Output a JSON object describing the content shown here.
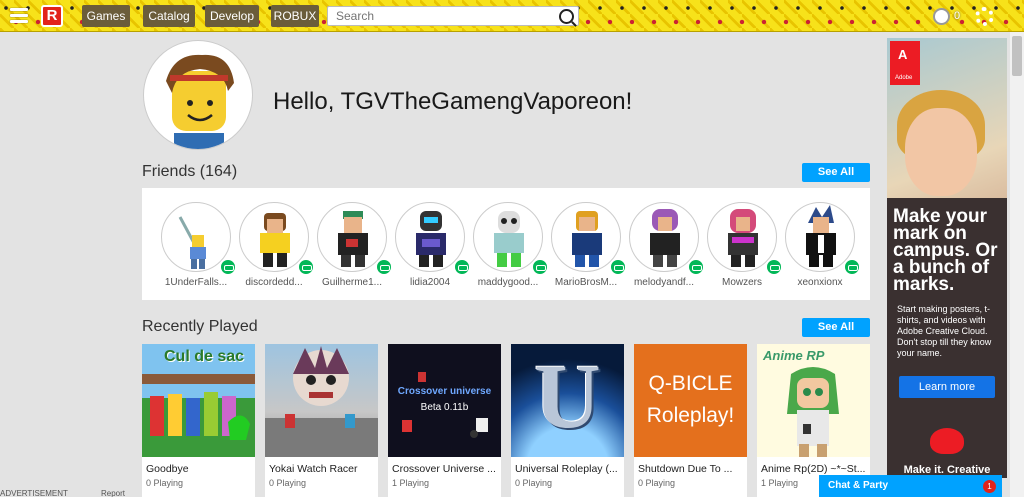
{
  "nav": {
    "logo": "R",
    "items": [
      "Games",
      "Catalog",
      "Develop",
      "ROBUX"
    ],
    "search_placeholder": "Search",
    "robux_count": "0"
  },
  "profile": {
    "greeting": "Hello, TGVTheGamengVaporeon!"
  },
  "friends": {
    "title": "Friends (164)",
    "see_all": "See All",
    "items": [
      {
        "name": "1UnderFalls..."
      },
      {
        "name": "discordedd..."
      },
      {
        "name": "Guilherme1..."
      },
      {
        "name": "lidia2004"
      },
      {
        "name": "maddygood..."
      },
      {
        "name": "MarioBrosM..."
      },
      {
        "name": "melodyandf..."
      },
      {
        "name": "Mowzers"
      },
      {
        "name": "xeonxionx"
      }
    ]
  },
  "recently_played": {
    "title": "Recently Played",
    "see_all": "See All",
    "games": [
      {
        "title": "Goodbye",
        "playing": "0 Playing",
        "thumb_text": "Cul de sac"
      },
      {
        "title": "Yokai Watch Racer",
        "playing": "0 Playing",
        "thumb_text": ""
      },
      {
        "title": "Crossover Universe ...",
        "playing": "1 Playing",
        "thumb_text": "Crossover universe",
        "thumb_sub": "Beta 0.11b"
      },
      {
        "title": "Universal Roleplay (...",
        "playing": "0 Playing",
        "thumb_text": "U"
      },
      {
        "title": "Shutdown Due To ...",
        "playing": "0 Playing",
        "thumb_text": "Q-BICLE",
        "thumb_sub": "Roleplay!"
      },
      {
        "title": "Anime Rp(2D) ~*~St...",
        "playing": "1 Playing",
        "thumb_text": "Anime RP"
      }
    ]
  },
  "ad": {
    "brand": "Adobe",
    "headline": "Make your mark on campus. Or a bunch of marks.",
    "copy": "Start making posters, t-shirts, and videos with Adobe Creative Cloud. Don't stop till they know your name.",
    "cta": "Learn more",
    "product": "Make it. Creative Cloud"
  },
  "footer": {
    "ad_label": "ADVERTISEMENT",
    "report": "Report"
  },
  "chat": {
    "label": "Chat & Party",
    "badge": "1"
  },
  "colors": {
    "accent": "#00a2ff",
    "online": "#02b757",
    "topbar": "#f7e21a"
  }
}
